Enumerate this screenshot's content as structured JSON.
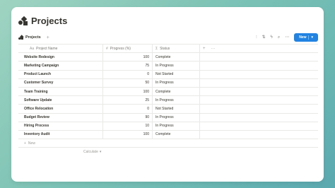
{
  "page": {
    "title": "Projects",
    "icon": "database-shapes-icon"
  },
  "view": {
    "tab_label": "Projects",
    "add_view_label": "+",
    "tools": [
      "filter-icon",
      "sort-icon",
      "lightning-icon",
      "search-icon",
      "more-icon"
    ],
    "tool_glyphs": [
      "⫶",
      "⇅",
      "ϟ",
      "⌕",
      "⋯"
    ],
    "new_button_label": "New",
    "new_button_caret": "▾"
  },
  "table": {
    "columns": [
      {
        "icon": "Aa",
        "label": "Project Name"
      },
      {
        "icon": "#",
        "label": "Progress (%)"
      },
      {
        "icon": "Σ",
        "label": "Status"
      }
    ],
    "add_column_label": "+",
    "more_label": "···",
    "rows": [
      {
        "name": "Website Redesign",
        "progress": "100",
        "status": "Complete"
      },
      {
        "name": "Marketing Campaign",
        "progress": "75",
        "status": "In Progress"
      },
      {
        "name": "Product Launch",
        "progress": "0",
        "status": "Not Started"
      },
      {
        "name": "Customer Survey",
        "progress": "50",
        "status": "In Progress"
      },
      {
        "name": "Team Training",
        "progress": "100",
        "status": "Complete"
      },
      {
        "name": "Software Update",
        "progress": "25",
        "status": "In Progress"
      },
      {
        "name": "Office Relocation",
        "progress": "0",
        "status": "Not Started"
      },
      {
        "name": "Budget Review",
        "progress": "90",
        "status": "In Progress"
      },
      {
        "name": "Hiring Process",
        "progress": "10",
        "status": "In Progress"
      },
      {
        "name": "Inventory Audit",
        "progress": "100",
        "status": "Complete"
      }
    ],
    "new_row_icon": "+",
    "new_row_label": "New",
    "calculate_label": "Calculate",
    "calculate_caret": "▾"
  },
  "colors": {
    "accent": "#2383e2",
    "text": "#37352f",
    "muted": "#9b9a97",
    "border": "#e9e9e7"
  }
}
